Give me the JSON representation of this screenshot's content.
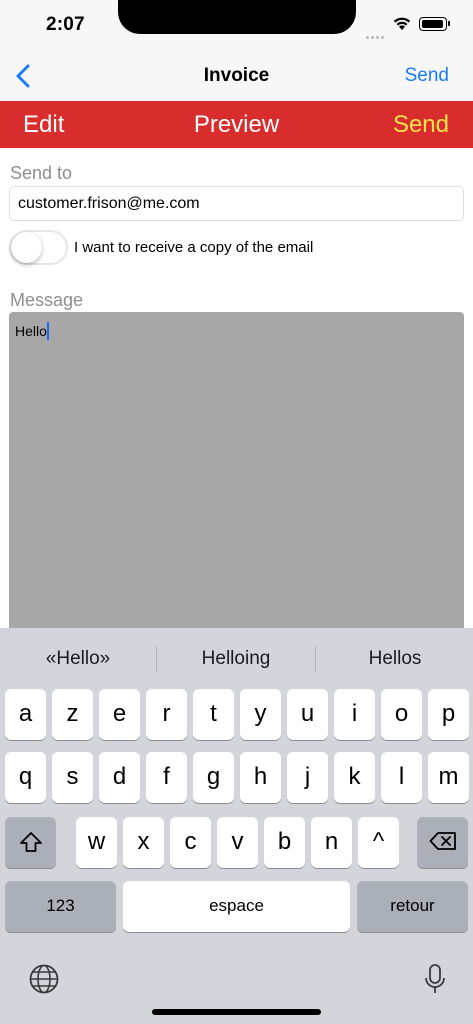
{
  "status_bar": {
    "time": "2:07"
  },
  "nav": {
    "title": "Invoice",
    "action": "Send",
    "back_icon": "chevron-left-icon"
  },
  "tabs": {
    "edit": "Edit",
    "preview": "Preview",
    "send": "Send",
    "active_color": "#fde24b",
    "strip_color": "#d82d2c"
  },
  "form": {
    "send_to_label": "Send to",
    "email_value": "customer.frison@me.com",
    "copy_toggle_label": "I want to receive a copy of the email",
    "copy_toggle_on": false,
    "message_label": "Message",
    "message_value": "Hello"
  },
  "keyboard": {
    "suggestions": [
      "«Hello»",
      "Helloing",
      "Hellos"
    ],
    "row1": [
      "a",
      "z",
      "e",
      "r",
      "t",
      "y",
      "u",
      "i",
      "o",
      "p"
    ],
    "row2": [
      "q",
      "s",
      "d",
      "f",
      "g",
      "h",
      "j",
      "k",
      "l",
      "m"
    ],
    "row3": [
      "w",
      "x",
      "c",
      "v",
      "b",
      "n",
      "^"
    ],
    "numbers_label": "123",
    "space_label": "espace",
    "return_label": "retour"
  }
}
